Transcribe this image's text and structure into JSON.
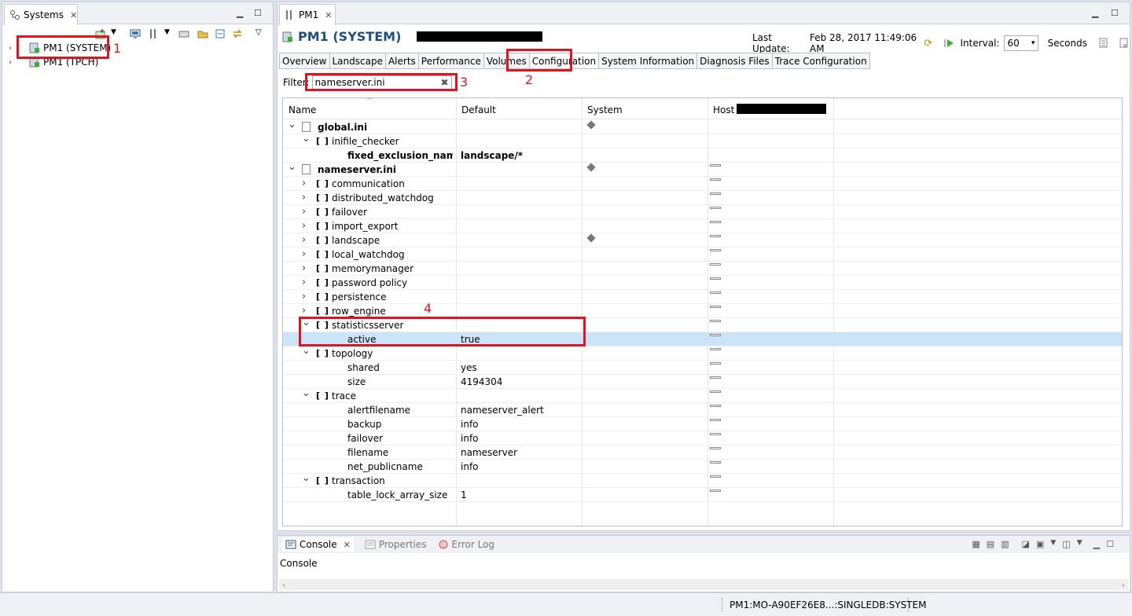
{
  "systems": {
    "tab_label": "Systems",
    "items": [
      {
        "label": "PM1 (SYSTEM)"
      },
      {
        "label": "PM1 (TPCH)"
      }
    ]
  },
  "editor": {
    "tab_label": "PM1",
    "title": "PM1 (SYSTEM)",
    "last_update_label": "Last Update:",
    "last_update_value": "Feb 28, 2017 11:49:06 AM",
    "interval_label": "Interval:",
    "interval_value": "60",
    "seconds_label": "Seconds",
    "subtabs": [
      "Overview",
      "Landscape",
      "Alerts",
      "Performance",
      "Volumes",
      "Configuration",
      "System Information",
      "Diagnosis Files",
      "Trace Configuration"
    ],
    "active_subtab": "Configuration",
    "filter_label": "Filter:",
    "filter_value": "nameserver.ini",
    "columns": [
      "Name",
      "Default",
      "System",
      "Host"
    ]
  },
  "rows": [
    {
      "name": "global.ini",
      "default": "",
      "system": true,
      "host": false,
      "bold": true
    },
    {
      "name": "inifile_checker",
      "default": "",
      "system": false,
      "host": false
    },
    {
      "name": "fixed_exclusion_nameser",
      "default": "landscape/*",
      "system": false,
      "host": false,
      "bold": true
    },
    {
      "name": "nameserver.ini",
      "default": "",
      "system": true,
      "host": true,
      "bold": true
    },
    {
      "name": "communication",
      "default": "",
      "system": false,
      "host": true
    },
    {
      "name": "distributed_watchdog",
      "default": "",
      "system": false,
      "host": true
    },
    {
      "name": "failover",
      "default": "",
      "system": false,
      "host": true
    },
    {
      "name": "import_export",
      "default": "",
      "system": false,
      "host": true
    },
    {
      "name": "landscape",
      "default": "",
      "system": true,
      "host": true
    },
    {
      "name": "local_watchdog",
      "default": "",
      "system": false,
      "host": true
    },
    {
      "name": "memorymanager",
      "default": "",
      "system": false,
      "host": true
    },
    {
      "name": "password policy",
      "default": "",
      "system": false,
      "host": true
    },
    {
      "name": "persistence",
      "default": "",
      "system": false,
      "host": true
    },
    {
      "name": "row_engine",
      "default": "",
      "system": false,
      "host": true
    },
    {
      "name": "statisticsserver",
      "default": "",
      "system": false,
      "host": true
    },
    {
      "name": "active",
      "default": "true",
      "system": false,
      "host": true,
      "selected": true
    },
    {
      "name": "topology",
      "default": "",
      "system": false,
      "host": true
    },
    {
      "name": "shared",
      "default": "yes",
      "system": false,
      "host": true
    },
    {
      "name": "size",
      "default": "4194304",
      "system": false,
      "host": true
    },
    {
      "name": "trace",
      "default": "",
      "system": false,
      "host": true
    },
    {
      "name": "alertfilename",
      "default": "nameserver_alert",
      "system": false,
      "host": true
    },
    {
      "name": "backup",
      "default": "info",
      "system": false,
      "host": true
    },
    {
      "name": "failover",
      "default": "info",
      "system": false,
      "host": true
    },
    {
      "name": "filename",
      "default": "nameserver",
      "system": false,
      "host": true
    },
    {
      "name": "net_publicname",
      "default": "info",
      "system": false,
      "host": true
    },
    {
      "name": "transaction",
      "default": "",
      "system": false,
      "host": true
    },
    {
      "name": "table_lock_array_size",
      "default": "1",
      "system": false,
      "host": true
    }
  ],
  "annotations": [
    "1",
    "2",
    "3",
    "4"
  ],
  "console": {
    "tabs": [
      "Console",
      "Properties",
      "Error Log"
    ],
    "label": "Console"
  },
  "status": "PM1:MO-A90EF26E8...:SINGLEDB:SYSTEM",
  "colors": {
    "accent_title": "#1f4f7e",
    "annotation_red": "#e0141e",
    "selected_row": "#cce4f7"
  }
}
